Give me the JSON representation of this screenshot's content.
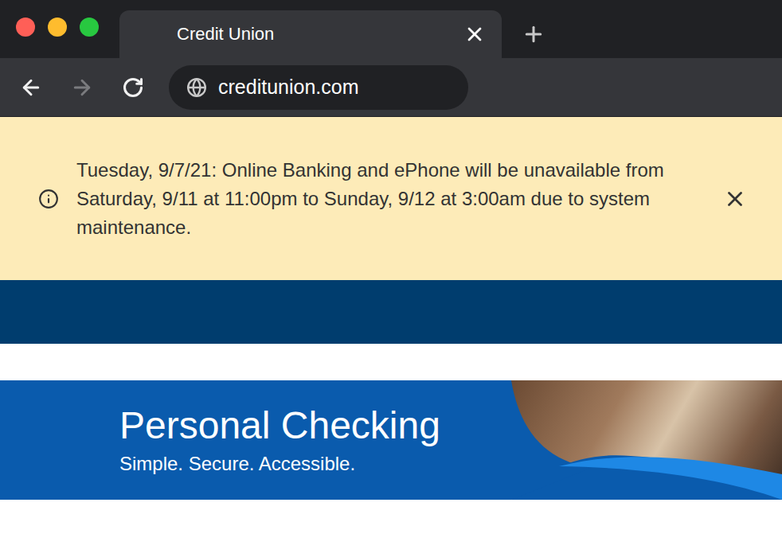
{
  "window": {
    "tab": {
      "title": "Credit Union",
      "selected": true
    },
    "address": "creditunion.com",
    "forward_disabled": true
  },
  "alert": {
    "text": "Tuesday, 9/7/21: Online Banking and ePhone will be unavailable from Saturday, 9/11 at 11:00pm to Sunday, 9/12 at 3:00am due to system maintenance."
  },
  "hero": {
    "title": "Personal Checking",
    "subtitle": "Simple. Secure. Accessible."
  }
}
